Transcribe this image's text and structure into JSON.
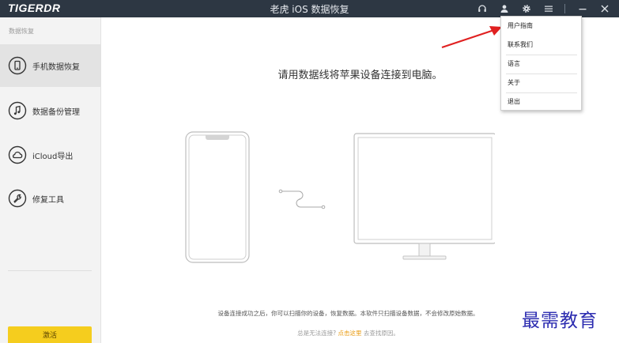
{
  "titlebar": {
    "logo": "TIGERDR",
    "title": "老虎 iOS 数据恢复",
    "icons": [
      "headset-icon",
      "user-icon",
      "gear-icon",
      "menu-icon",
      "minimize-icon",
      "close-icon"
    ]
  },
  "sidebar": {
    "heading": "数据恢复",
    "items": [
      {
        "label": "手机数据恢复",
        "icon": "phone-icon",
        "active": true
      },
      {
        "label": "数据备份管理",
        "icon": "music-note-icon",
        "active": false
      },
      {
        "label": "iCloud导出",
        "icon": "cloud-icon",
        "active": false
      },
      {
        "label": "修复工具",
        "icon": "wrench-icon",
        "active": false
      }
    ],
    "activate_label": "激活"
  },
  "main": {
    "instruction": "请用数据线将苹果设备连接到电脑。",
    "footer_note": "设备连接成功之后，你可以扫描你的设备，恢复数据。本软件只扫描设备数据，不会修改原始数据。",
    "help_prefix": "总是无法连接?",
    "help_link": "点击这里",
    "help_suffix": "去查找原因。"
  },
  "menu": {
    "items": [
      "用户指南",
      "联系我们",
      "语言",
      "关于",
      "退出"
    ]
  },
  "watermark": "最需教育",
  "colors": {
    "titlebar": "#2d3743",
    "activate": "#f5cd1e",
    "link": "#e99a0e",
    "arrow": "#e02020",
    "watermark": "#2c2cb0"
  }
}
